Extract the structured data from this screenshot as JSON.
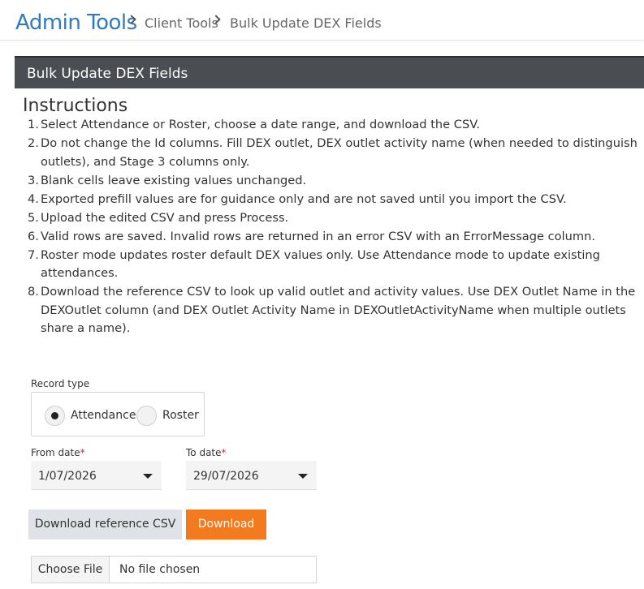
{
  "breadcrumb": {
    "root": "Admin Tools",
    "items": [
      "Client Tools",
      "Bulk Update DEX Fields"
    ]
  },
  "panel": {
    "title": "Bulk Update DEX Fields"
  },
  "instructions": {
    "title": "Instructions",
    "items": [
      {
        "num": "1.",
        "text": "Select Attendance or Roster, choose a date range, and download the CSV."
      },
      {
        "num": "2.",
        "text": "Do not change the Id columns. Fill DEX outlet, DEX outlet activity name (when needed to distinguish outlets), and Stage 3 columns only."
      },
      {
        "num": "3.",
        "text": "Blank cells leave existing values unchanged."
      },
      {
        "num": "4.",
        "text": "Exported prefill values are for guidance only and are not saved until you import the CSV."
      },
      {
        "num": "5.",
        "text": "Upload the edited CSV and press Process."
      },
      {
        "num": "6.",
        "text": "Valid rows are saved. Invalid rows are returned in an error CSV with an ErrorMessage column."
      },
      {
        "num": "7.",
        "text": "Roster mode updates roster default DEX values only. Use Attendance mode to update existing attendances."
      },
      {
        "num": "8.",
        "text": "Download the reference CSV to look up valid outlet and activity values. Use DEX Outlet Name in the DEXOutlet column (and DEX Outlet Activity Name in DEXOutletActivityName when multiple outlets share a name)."
      }
    ]
  },
  "form": {
    "record_type_label": "Record type",
    "record_type_options": [
      "Attendance",
      "Roster"
    ],
    "record_type_selected": "Attendance",
    "from_date_label": "From date",
    "from_date_value": "1/07/2026",
    "to_date_label": "To date",
    "to_date_value": "29/07/2026",
    "required_marker": "*",
    "download_reference_label": "Download reference CSV",
    "download_label": "Download",
    "choose_file_label": "Choose File",
    "no_file_label": "No file chosen"
  },
  "colors": {
    "brand_blue": "#2f7bbf",
    "header_dark": "#4a4e52",
    "accent_orange": "#f47a1f",
    "required_red": "#d9262c"
  }
}
